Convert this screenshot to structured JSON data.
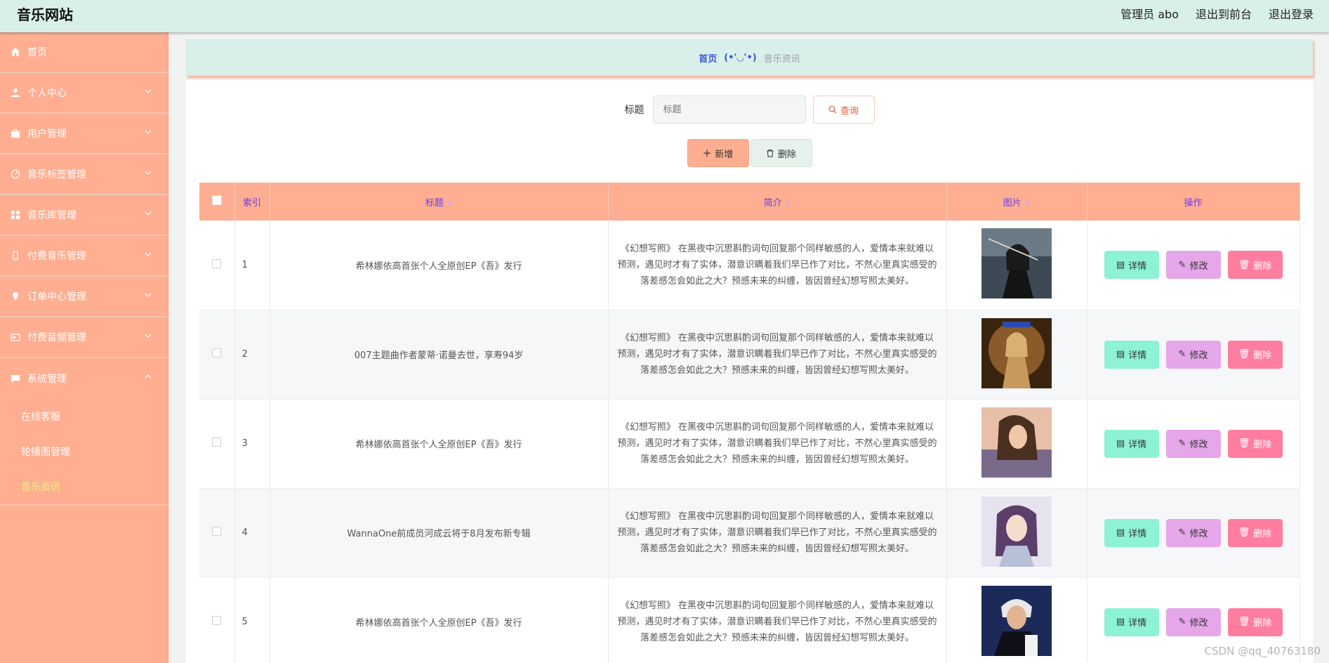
{
  "header": {
    "site_title": "音乐网站",
    "admin_label": "管理员 abo",
    "back_label": "退出到前台",
    "logout_label": "退出登录"
  },
  "sidebar": {
    "items": [
      {
        "label": "首页",
        "icon": "home-icon"
      },
      {
        "label": "个人中心",
        "icon": "user-icon"
      },
      {
        "label": "用户管理",
        "icon": "briefcase-icon"
      },
      {
        "label": "音乐标签管理",
        "icon": "gauge-icon"
      },
      {
        "label": "音乐库管理",
        "icon": "grid-icon"
      },
      {
        "label": "付费音乐管理",
        "icon": "phone-icon"
      },
      {
        "label": "订单中心管理",
        "icon": "pin-icon"
      },
      {
        "label": "付费音频管理",
        "icon": "card-icon"
      },
      {
        "label": "系统管理",
        "icon": "chat-icon"
      }
    ],
    "sub_items": [
      {
        "label": "在线客服"
      },
      {
        "label": "轮播图管理"
      },
      {
        "label": "音乐资讯"
      }
    ]
  },
  "breadcrumb": {
    "home": "首页",
    "sep": "(•'◡'•)",
    "current": "音乐资讯"
  },
  "search": {
    "label": "标题",
    "placeholder": "标题",
    "query_label": "查询"
  },
  "actions": {
    "add_label": "新增",
    "delete_label": "删除"
  },
  "table": {
    "headers": {
      "index": "索引",
      "title": "标题",
      "intro": "简介",
      "image": "图片",
      "ops": "操作"
    },
    "rows": [
      {
        "index": "1",
        "title": "希林娜依高首张个人全原创EP《吾》发行",
        "intro": "《幻想写照》        在黑夜中沉思斟酌词句回复那个同样敏感的人，爱情本来就难以预测，遇见时才有了实体，潜意识瞒着我们早已作了对比，不然心里真实感受的落差感怎会如此之大？预感未来的纠缠，皆因曾经幻想写照太美好。",
        "image": "portrait-photo"
      },
      {
        "index": "2",
        "title": "007主题曲作者蒙蒂·诺曼去世，享寿94岁",
        "intro": "《幻想写照》        在黑夜中沉思斟酌词句回复那个同样敏感的人，爱情本来就难以预测，遇见时才有了实体，潜意识瞒着我们早已作了对比，不然心里真实感受的落差感怎会如此之大？预感未来的纠缠，皆因曾经幻想写照太美好。",
        "image": "portrait-photo"
      },
      {
        "index": "3",
        "title": "希林娜依高首张个人全原创EP《吾》发行",
        "intro": "《幻想写照》        在黑夜中沉思斟酌词句回复那个同样敏感的人，爱情本来就难以预测，遇见时才有了实体，潜意识瞒着我们早已作了对比，不然心里真实感受的落差感怎会如此之大？预感未来的纠缠，皆因曾经幻想写照太美好。",
        "image": "portrait-photo"
      },
      {
        "index": "4",
        "title": "WannaOne前成员河成云将于8月发布新专辑",
        "intro": "《幻想写照》        在黑夜中沉思斟酌词句回复那个同样敏感的人，爱情本来就难以预测，遇见时才有了实体，潜意识瞒着我们早已作了对比，不然心里真实感受的落差感怎会如此之大？预感未来的纠缠，皆因曾经幻想写照太美好。",
        "image": "portrait-photo"
      },
      {
        "index": "5",
        "title": "希林娜依高首张个人全原创EP《吾》发行",
        "intro": "《幻想写照》        在黑夜中沉思斟酌词句回复那个同样敏感的人，爱情本来就难以预测，遇见时才有了实体，潜意识瞒着我们早已作了对比，不然心里真实感受的落差感怎会如此之大？预感未来的纠缠，皆因曾经幻想写照太美好。",
        "image": "portrait-photo"
      }
    ],
    "op_labels": {
      "detail": "详情",
      "edit": "修改",
      "delete": "删除"
    }
  },
  "colors": {
    "accent": "#ffae91",
    "header_bg": "#d9efe9",
    "detail_btn": "#8ef2d4",
    "edit_btn": "#e6a6ea",
    "delete_btn": "#ff7d9e"
  },
  "watermark": "CSDN @qq_40763180"
}
